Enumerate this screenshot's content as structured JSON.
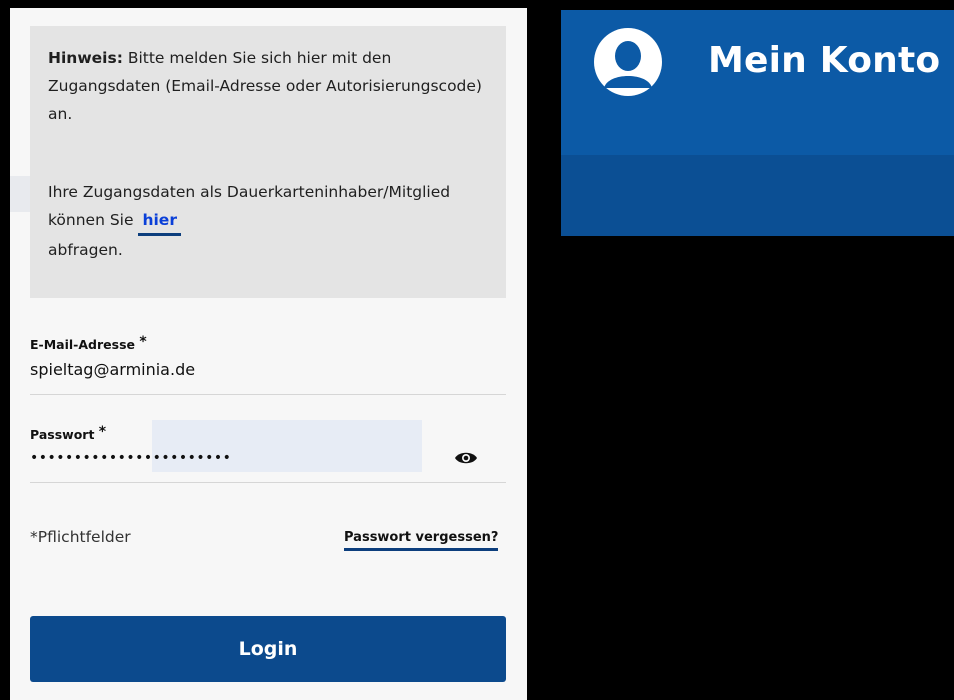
{
  "login": {
    "hint_bold": "Hinweis:",
    "hint_text": " Bitte melden Sie sich hier mit den Zugangsdaten (Email-Adresse oder Autorisierungscode) an.",
    "info_text": "Ihre Zugangsdaten als Dauerkarteninhaber/Mitglied können Sie ",
    "info_link": "hier",
    "info_suffix": "abfragen.",
    "email_label": "E-Mail-Adresse",
    "email_value": "spieltag@arminia.de",
    "password_label": "Passwort",
    "password_value": "•••••••••••••••••••••••",
    "required_star": "*",
    "required_note": "*Pflichtfelder",
    "forgot_link": "Passwort vergessen?",
    "login_button": "Login"
  },
  "account": {
    "title": "Mein Konto",
    "icon": "user-avatar-icon"
  },
  "colors": {
    "primary": "#0c4a8d",
    "header_blue": "#0c5aa6",
    "link_blue": "#0a3fd8"
  }
}
